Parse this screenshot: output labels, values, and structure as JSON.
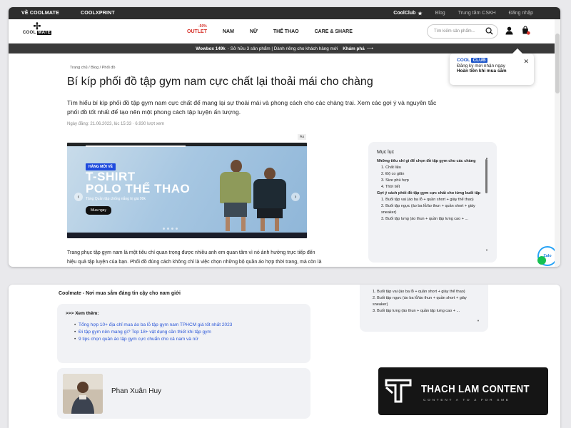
{
  "header": {
    "top_left": [
      "VỀ COOLMATE",
      "COOLXPRINT"
    ],
    "top_right": [
      "CoolClub",
      "Blog",
      "Trung tâm CSKH",
      "Đăng nhập"
    ],
    "logo": "COOL MATE",
    "outlet_badge": "-50%",
    "menu": [
      "OUTLET",
      "NAM",
      "NỮ",
      "THỂ THAO",
      "CARE & SHARE"
    ],
    "search_placeholder": "Tìm kiếm sản phẩm..."
  },
  "promo": {
    "bold": "Wowbox 149k",
    "text": "- Sở hữu 3 sản phẩm | Dành riêng cho khách hàng mới",
    "cta": "Khám phá"
  },
  "breadcrumb": "Trang chủ / Blog / Phối đồ",
  "article": {
    "title": "Bí kíp phối đồ tập gym nam cực chất lại thoải mái cho chàng",
    "intro": "Tìm hiểu bí kíp phối đồ tập gym nam cực chất để mang lại sự thoải mái và phong cách cho các chàng trai. Xem các gợi ý và nguyên tắc phối đồ tốt nhất để tạo nên một phong cách tập luyện ấn tượng.",
    "meta": "Ngày đăng: 21.06.2023, lúc 15:33  ·  6.930 lượt xem",
    "az_badge": "Aa",
    "body": "Trang phục tập gym nam là một tiêu chí quan trọng được nhiều anh em quan tâm vì nó ảnh hưởng trực tiếp đến hiệu quả tập luyện của bạn. Phối đồ đúng cách không chỉ là việc chọn những bộ quần áo hợp thời trang, mà còn là việc kết hợp các loại vải, kiểu dáng và màu sắc sao cho phù hợp với mọi bài tập."
  },
  "hero": {
    "badge": "HÀNG MỚI VỀ",
    "line1": "T-SHIRT",
    "line2": "POLO THỂ THAO",
    "sub": "Tặng Quần tập chống nắng trị giá 99k",
    "button": "Mua ngay"
  },
  "toc": {
    "title": "Mục lục",
    "items": [
      {
        "text": "Những tiêu chí gì để chọn đồ tập gym cho các chàng",
        "level": 1
      },
      {
        "text": "1. Chất liệu",
        "level": 2
      },
      {
        "text": "2. Độ co giãn",
        "level": 2
      },
      {
        "text": "3. Size phù hợp",
        "level": 2
      },
      {
        "text": "4. Thời tiết",
        "level": 2
      },
      {
        "text": "Gợi ý cách phối đồ tập gym cực chất cho từng buổi tập",
        "level": 1
      },
      {
        "text": "1. Buổi tập vai (áo ba lỗ + quần short + giày thể thao)",
        "level": 2
      },
      {
        "text": "2. Buổi tập ngực (áo ba lỗ/áo thun + quần short + giày sneaker)",
        "level": 2
      },
      {
        "text": "3. Buổi tập lưng (áo thun + quần tập lưng cao + ...",
        "level": 2
      }
    ]
  },
  "popup": {
    "brand_a": "COOL",
    "brand_b": "CLUB",
    "line1": "Đăng ký mới nhận ngay",
    "line2": "Hoàn tiền khi mua sắm"
  },
  "zalo": "Zalo",
  "bottom": {
    "tagline": "Coolmate - Nơi mua sắm đáng tin cậy cho nam giới",
    "see_more_title": ">>> Xem thêm:",
    "see_more_links": [
      "Tổng hợp 10+ địa chỉ mua áo ba lỗ tập gym nam TPHCM giá tốt nhất 2023",
      "Đi tập gym nên mang gì? Top 18+ vật dụng cần thiết khi tập gym",
      "9 tips chọn quần áo tập gym cực chuẩn cho cả nam và nữ"
    ],
    "author": "Phan Xuân Huy",
    "toc_items": [
      "1. Buổi tập vai (áo ba lỗ + quần short + giày thể thao)",
      "2. Buổi tập ngực (áo ba lỗ/áo thun + quần short + giày sneaker)",
      "3. Buổi tập lưng (áo thun + quần tập lưng cao + ..."
    ]
  },
  "watermark": {
    "title": "THACH LAM CONTENT",
    "subtitle": "CONTENT A TO Z FOR SME"
  },
  "colors": {
    "accent_red": "#d6322a",
    "link_blue": "#2b57d8",
    "hero_badge": "#1f4bdd",
    "dark_bar": "#2d2d2d"
  },
  "icons": [
    "star-icon",
    "search-icon",
    "user-icon",
    "cart-icon",
    "close-icon",
    "arrow-right-icon",
    "chevron-left-icon",
    "chevron-right-icon",
    "eye-icon",
    "zalo-icon"
  ]
}
